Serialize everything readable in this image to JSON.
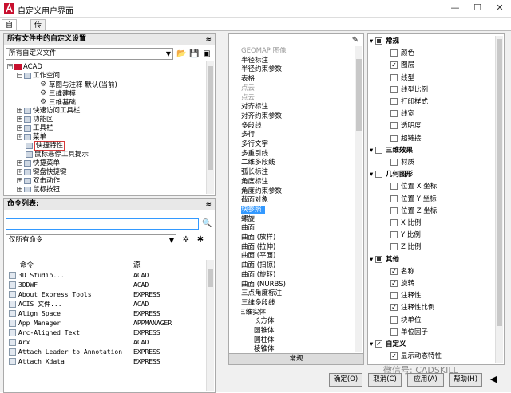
{
  "window": {
    "title": "自定义用户界面",
    "minimize": "—",
    "restore": "☐",
    "close": "✕"
  },
  "tabs": [
    "自定义",
    "传输"
  ],
  "left_panel": {
    "header": "所有文件中的自定义设置",
    "collapse_glyph": "≈",
    "combo_value": "所有自定义文件",
    "tree": [
      {
        "label": "ACAD",
        "exp": "−",
        "icon": "acad"
      },
      {
        "label": "工作空间",
        "exp": "−",
        "icon": "folder"
      },
      {
        "label": "草图与注释 默认(当前)",
        "icon": "gear"
      },
      {
        "label": "三维建模",
        "icon": "gear"
      },
      {
        "label": "三维基础",
        "icon": "gear"
      },
      {
        "label": "快速访问工具栏",
        "exp": "+",
        "icon": "folder"
      },
      {
        "label": "功能区",
        "exp": "+",
        "icon": "folder"
      },
      {
        "label": "工具栏",
        "exp": "+",
        "icon": "folder"
      },
      {
        "label": "菜单",
        "exp": "+",
        "icon": "folder"
      },
      {
        "label": "快捷特性",
        "icon": "folder",
        "highlight": true
      },
      {
        "label": "鼠标悬停工具提示",
        "icon": "folder"
      },
      {
        "label": "快捷菜单",
        "exp": "+",
        "icon": "folder"
      },
      {
        "label": "键盘快捷键",
        "exp": "+",
        "icon": "folder"
      },
      {
        "label": "双击动作",
        "exp": "+",
        "icon": "folder"
      },
      {
        "label": "鼠标按钮",
        "exp": "+",
        "icon": "folder"
      }
    ]
  },
  "command_panel": {
    "header": "命令列表:",
    "search_value": "",
    "filter_value": "仅所有命令",
    "columns": [
      "命令",
      "源"
    ],
    "rows": [
      {
        "name": "3D Studio...",
        "source": "ACAD"
      },
      {
        "name": "3DDWF",
        "source": "ACAD"
      },
      {
        "name": "About Express Tools",
        "source": "EXPRESS"
      },
      {
        "name": "ACIS 文件...",
        "source": "ACAD"
      },
      {
        "name": "Align Space",
        "source": "EXPRESS"
      },
      {
        "name": "App Manager",
        "source": "APPMANAGER"
      },
      {
        "name": "Arc-Aligned Text",
        "source": "EXPRESS"
      },
      {
        "name": "Arx",
        "source": "ACAD"
      },
      {
        "name": "Attach Leader to Annotation",
        "source": "EXPRESS"
      },
      {
        "name": "Attach Xdata",
        "source": "EXPRESS"
      }
    ]
  },
  "object_list": [
    {
      "label": "GEOMAP 图像",
      "style": "grey"
    },
    {
      "label": "半径标注"
    },
    {
      "label": "半径约束参数"
    },
    {
      "label": "表格"
    },
    {
      "label": "点云",
      "style": "grey"
    },
    {
      "label": "点云",
      "style": "grey"
    },
    {
      "label": "对齐标注"
    },
    {
      "label": "对齐约束参数"
    },
    {
      "label": "多段线"
    },
    {
      "label": "多行"
    },
    {
      "label": "多行文字"
    },
    {
      "label": "多重引线"
    },
    {
      "label": "二维多段线"
    },
    {
      "label": "弧长标注"
    },
    {
      "label": "角度标注"
    },
    {
      "label": "角度约束参数"
    },
    {
      "label": "截面对象"
    },
    {
      "label": "块参照",
      "style": "sel"
    },
    {
      "label": "螺旋"
    },
    {
      "label": "曲面"
    },
    {
      "label": "曲面 (放样)"
    },
    {
      "label": "曲面 (拉伸)"
    },
    {
      "label": "曲面 (平面)"
    },
    {
      "label": "曲面 (扫掠)"
    },
    {
      "label": "曲面 (旋转)"
    },
    {
      "label": "曲面 (NURBS)"
    },
    {
      "label": "三点角度标注"
    },
    {
      "label": "三维多段线"
    },
    {
      "label": "三维实体",
      "exp": "▾"
    },
    {
      "label": "长方体",
      "indent": true
    },
    {
      "label": "圆锥体",
      "indent": true
    },
    {
      "label": "圆柱体",
      "indent": true
    },
    {
      "label": "棱锥体",
      "indent": true
    }
  ],
  "list_footer": "常规",
  "properties": [
    {
      "label": "常规",
      "group": true,
      "state": "filled"
    },
    {
      "label": "颜色",
      "state": "off"
    },
    {
      "label": "图层",
      "state": "on"
    },
    {
      "label": "线型",
      "state": "off"
    },
    {
      "label": "线型比例",
      "state": "off"
    },
    {
      "label": "打印样式",
      "state": "off"
    },
    {
      "label": "线宽",
      "state": "off"
    },
    {
      "label": "透明度",
      "state": "off"
    },
    {
      "label": "超链接",
      "state": "off"
    },
    {
      "label": "三维效果",
      "group": true,
      "state": "off"
    },
    {
      "label": "材质",
      "state": "off"
    },
    {
      "label": "几何图形",
      "group": true,
      "state": "off"
    },
    {
      "label": "位置 X 坐标",
      "state": "off"
    },
    {
      "label": "位置 Y 坐标",
      "state": "off"
    },
    {
      "label": "位置 Z 坐标",
      "state": "off"
    },
    {
      "label": "X 比例",
      "state": "off"
    },
    {
      "label": "Y 比例",
      "state": "off"
    },
    {
      "label": "Z 比例",
      "state": "off"
    },
    {
      "label": "其他",
      "group": true,
      "state": "filled"
    },
    {
      "label": "名称",
      "state": "on"
    },
    {
      "label": "旋转",
      "state": "on"
    },
    {
      "label": "注释性",
      "state": "off"
    },
    {
      "label": "注释性比例",
      "state": "on"
    },
    {
      "label": "块单位",
      "state": "off"
    },
    {
      "label": "单位因子",
      "state": "off"
    },
    {
      "label": "自定义",
      "group": true,
      "state": "on"
    },
    {
      "label": "显示动态特性",
      "state": "on"
    }
  ],
  "buttons": {
    "ok": "确定(O)",
    "cancel": "取消(C)",
    "apply": "应用(A)",
    "help": "帮助(H)"
  },
  "watermark": "微信号: CADSKILL",
  "colors": {
    "selection": "#3399ff",
    "highlight_box": "#d63a3a",
    "acad_red": "#c8102e"
  }
}
